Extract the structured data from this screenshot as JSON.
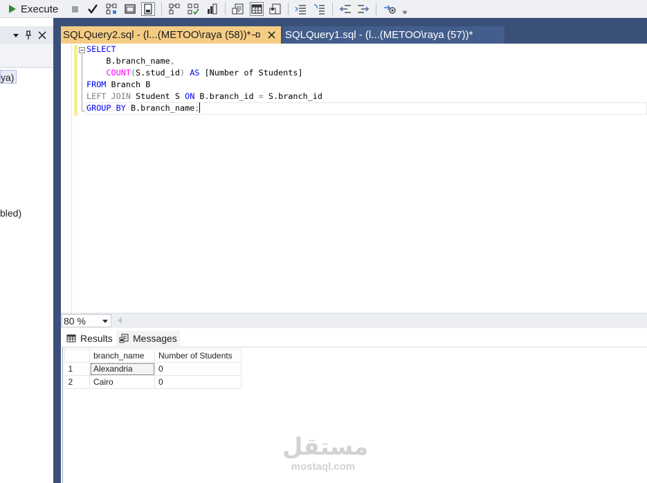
{
  "toolbar": {
    "execute_label": "Execute"
  },
  "left_pane": {
    "text_fragment_1": "ya)",
    "text_fragment_2": "bled)"
  },
  "tabs": [
    {
      "title": "SQLQuery2.sql - (l...(METOO\\raya (58))*",
      "active": true
    },
    {
      "title": "SQLQuery1.sql - (l...(METOO\\raya (57))*",
      "active": false
    }
  ],
  "editor": {
    "lines": [
      "SELECT",
      "    B.branch_name,",
      "    COUNT(S.stud_id) AS [Number of Students]",
      "FROM Branch B",
      "LEFT JOIN Student S ON B.branch_id = S.branch_id",
      "GROUP BY B.branch_name;"
    ]
  },
  "zoom": {
    "value": "80 %"
  },
  "results": {
    "tab_results": "Results",
    "tab_messages": "Messages",
    "columns": [
      "branch_name",
      "Number of Students"
    ],
    "rows": [
      {
        "num": "1",
        "branch_name": "Alexandria",
        "count": "0"
      },
      {
        "num": "2",
        "branch_name": "Cairo",
        "count": "0"
      }
    ]
  },
  "watermark": {
    "brand": "مستقل",
    "url": "mostaql.com"
  },
  "colors": {
    "active_tab": "#f5cc84",
    "inactive_tab": "#435e8c",
    "tabstrip_bg": "#3a5078",
    "keyword": "#0000ff",
    "function": "#ff00ff"
  }
}
